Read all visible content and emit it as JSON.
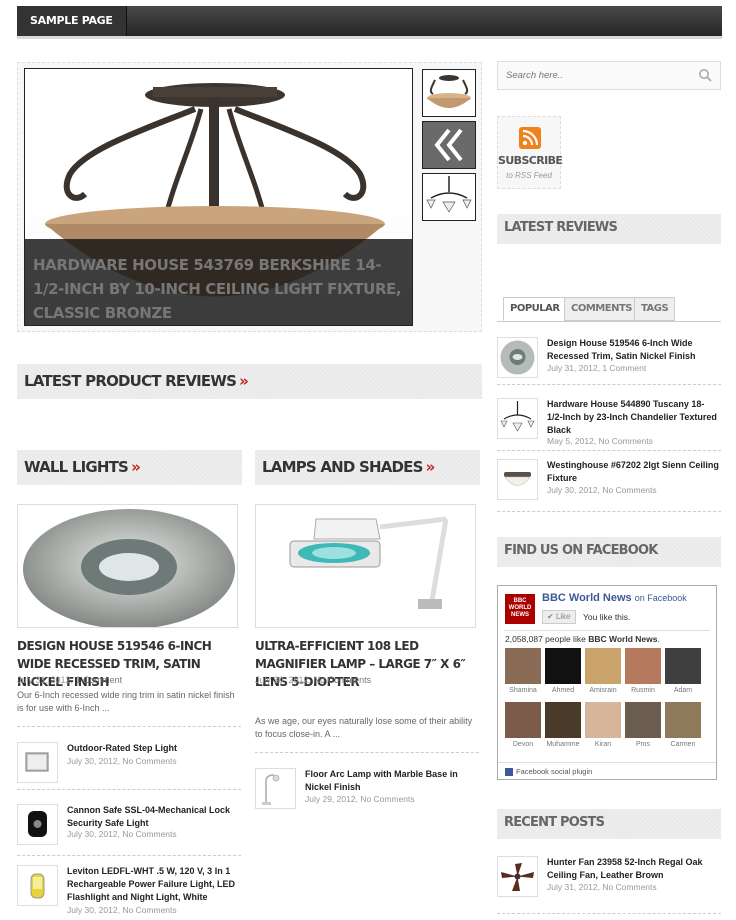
{
  "nav": {
    "items": [
      "SAMPLE PAGE"
    ]
  },
  "slider": {
    "caption": "Hardware House 543769 Berkshire 14-1/2-Inch by 10-Inch Ceiling Light Fixture, Classic Bronze"
  },
  "headings": {
    "latest_product_reviews": "LATEST PRODUCT REVIEWS",
    "wall_lights": "WALL LIGHTS",
    "lamps_and_shades": "LAMPS AND SHADES",
    "arrow": "»"
  },
  "wall_lights": {
    "featured": {
      "title": "Design House 519546 6-Inch Wide Recessed Trim, Satin Nickel Finish",
      "date": "July 31, 2012,",
      "comments": "1 Comment",
      "excerpt": "Our 6-Inch recessed wide ring trim in satin nickel finish is for use with 6-Inch ..."
    },
    "items": [
      {
        "title": "Outdoor-Rated Step Light",
        "date": "July 30, 2012,",
        "comments": "No Comments"
      },
      {
        "title": "Cannon Safe SSL-04-Mechanical Lock Security Safe Light",
        "date": "July 30, 2012,",
        "comments": "No Comments"
      },
      {
        "title": "Leviton LEDFL-WHT .5 W, 120 V, 3 In 1 Rechargeable Power Failure Light, LED Flashlight and Night Light, White",
        "date": "July 30, 2012,",
        "comments": "No Comments"
      }
    ]
  },
  "lamps_and_shades": {
    "featured": {
      "title": "Ultra-Efficient 108 LED Magnifier Lamp – Large 7″ x 6″ Lens 5-Diopter",
      "date": "July 30, 2012,",
      "comments": "No Comments",
      "excerpt": "As we age, our eyes naturally lose some of their ability to focus close-in. A ..."
    },
    "items": [
      {
        "title": "Floor Arc Lamp with Marble Base in Nickel Finish",
        "date": "July 29, 2012,",
        "comments": "No Comments"
      }
    ]
  },
  "sidebar": {
    "search_placeholder": "Search here..",
    "subscribe": "SUBSCRIBE",
    "to_rss": "to RSS Feed",
    "latest_reviews": "LATEST REVIEWS",
    "tabs": [
      "POPULAR",
      "COMMENTS",
      "TAGS"
    ],
    "popular": [
      {
        "title": "Design House 519546 6-Inch Wide Recessed Trim, Satin Nickel Finish",
        "date": "July 31, 2012,",
        "comments": "1 Comment"
      },
      {
        "title": "Hardware House 544890 Tuscany 18-1/2-Inch by 23-Inch Chandelier Textured Black",
        "date": "May 5, 2012,",
        "comments": "No Comments"
      },
      {
        "title": "Westinghouse #67202 2lgt Sienn Ceiling Fixture",
        "date": "July 30, 2012,",
        "comments": "No Comments"
      }
    ],
    "find_us": "FIND US ON FACEBOOK",
    "fb": {
      "page_name": "BBC World News",
      "on_facebook": "on Facebook",
      "like": "Like",
      "you_like": "You like this.",
      "count_text": "2,058,087 people like",
      "count_page": "BBC World News",
      "faces": [
        "Shamina",
        "Ahmed",
        "Amisrain",
        "Rusmin",
        "Adam",
        "Devon",
        "Muhamme",
        "Kiran",
        "Pms",
        "Carmen"
      ],
      "plugin": "Facebook social plugin",
      "logo_text": "BBC WORLD NEWS"
    },
    "recent_posts": "RECENT POSTS",
    "recent": [
      {
        "title": "Hunter Fan 23958 52-Inch Regal Oak Ceiling Fan, Leather Brown",
        "date": "July 31, 2012,",
        "comments": "No Comments"
      }
    ]
  },
  "colors": {
    "accent": "#c0201b",
    "nav_bg": "#333333",
    "heading_bg": "#e9e9e9",
    "fb_blue": "#3b5998"
  }
}
